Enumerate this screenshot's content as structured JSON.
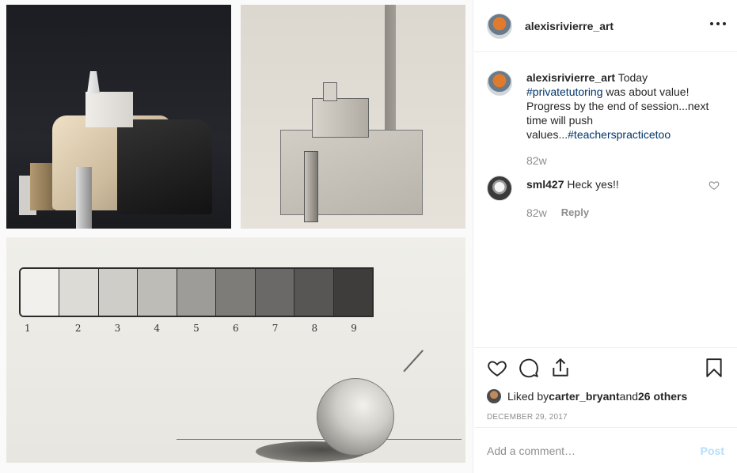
{
  "post": {
    "author": "alexisrivierre_art",
    "more_icon": "more-horizontal-icon"
  },
  "caption": {
    "author": "alexisrivierre_art",
    "text_1": " Today ",
    "hashtag_1": "#privatetutoring",
    "text_2": " was about value! Progress by the end of session...next time will push values...",
    "hashtag_2": "#teacherspracticetoo",
    "age": "82w"
  },
  "comments": [
    {
      "user": "sml427",
      "text": " Heck yes!!",
      "age": "82w",
      "reply_label": "Reply"
    }
  ],
  "actions": {
    "icons": [
      "heart-icon",
      "comment-icon",
      "share-icon",
      "bookmark-icon"
    ]
  },
  "likes": {
    "prefix": "Liked by ",
    "user": "carter_bryant",
    "middle": " and ",
    "others": "26 others"
  },
  "date": "DECEMBER 29, 2017",
  "add_comment": {
    "placeholder": "Add a comment…",
    "post_label": "Post"
  },
  "value_scale": {
    "numbers": [
      "1",
      "2",
      "3",
      "4",
      "5",
      "6",
      "7",
      "8",
      "9"
    ],
    "swatch_colors": [
      "#f1f0ec",
      "#dcdbd6",
      "#cecdc8",
      "#bdbcb7",
      "#9d9c98",
      "#7d7c79",
      "#6a6967",
      "#575654",
      "#3e3d3c"
    ]
  },
  "colors": {
    "link": "#003569",
    "muted": "#8e8e8e",
    "post_disabled": "#b2dffc"
  }
}
